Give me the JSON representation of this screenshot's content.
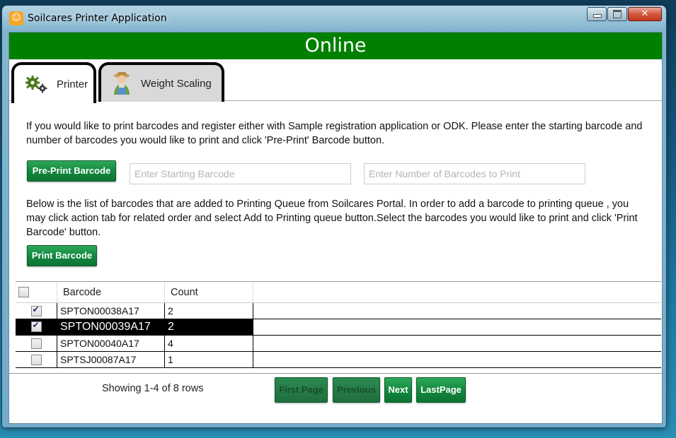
{
  "window": {
    "title": "Soilcares Printer Application",
    "close_glyph": "✕"
  },
  "status": {
    "text": "Online",
    "color": "#008000"
  },
  "tabs": [
    {
      "label": "Printer",
      "icon": "gears-icon",
      "active": true
    },
    {
      "label": "Weight Scaling",
      "icon": "farmer-icon",
      "active": false
    }
  ],
  "printer": {
    "intro_text": "If you would like to print barcodes and register either with Sample registration application or ODK. Please enter the starting barcode and number of barcodes you would like to print and click 'Pre-Print' Barcode button.",
    "preprint_label": "Pre-Print Barcode",
    "start_barcode_placeholder": "Enter Starting Barcode",
    "count_placeholder": "Enter Number of Barcodes to Print",
    "queue_text": " Below is the list of barcodes that are added to Printing Queue from Soilcares Portal. In order to add a barcode to printing queue , you may click action tab for related order and select Add to Printing queue button.Select the barcodes you would like to print and click 'Print Barcode' button.",
    "print_label": "Print Barcode"
  },
  "grid": {
    "columns": [
      "",
      "Barcode",
      "Count"
    ],
    "rows": [
      {
        "checked": true,
        "barcode": "SPTON00038A17",
        "count": "2",
        "selected": false
      },
      {
        "checked": true,
        "barcode": "SPTON00039A17",
        "count": "2",
        "selected": true
      },
      {
        "checked": false,
        "barcode": "SPTON00040A17",
        "count": "4",
        "selected": false
      },
      {
        "checked": false,
        "barcode": "SPTSJ00087A17",
        "count": "1",
        "selected": false
      }
    ]
  },
  "pager": {
    "summary": "Showing 1-4 of 8 rows",
    "first_label": "First Page",
    "previous_label": "Previous",
    "next_label": "Next",
    "last_label": "LastPage"
  }
}
